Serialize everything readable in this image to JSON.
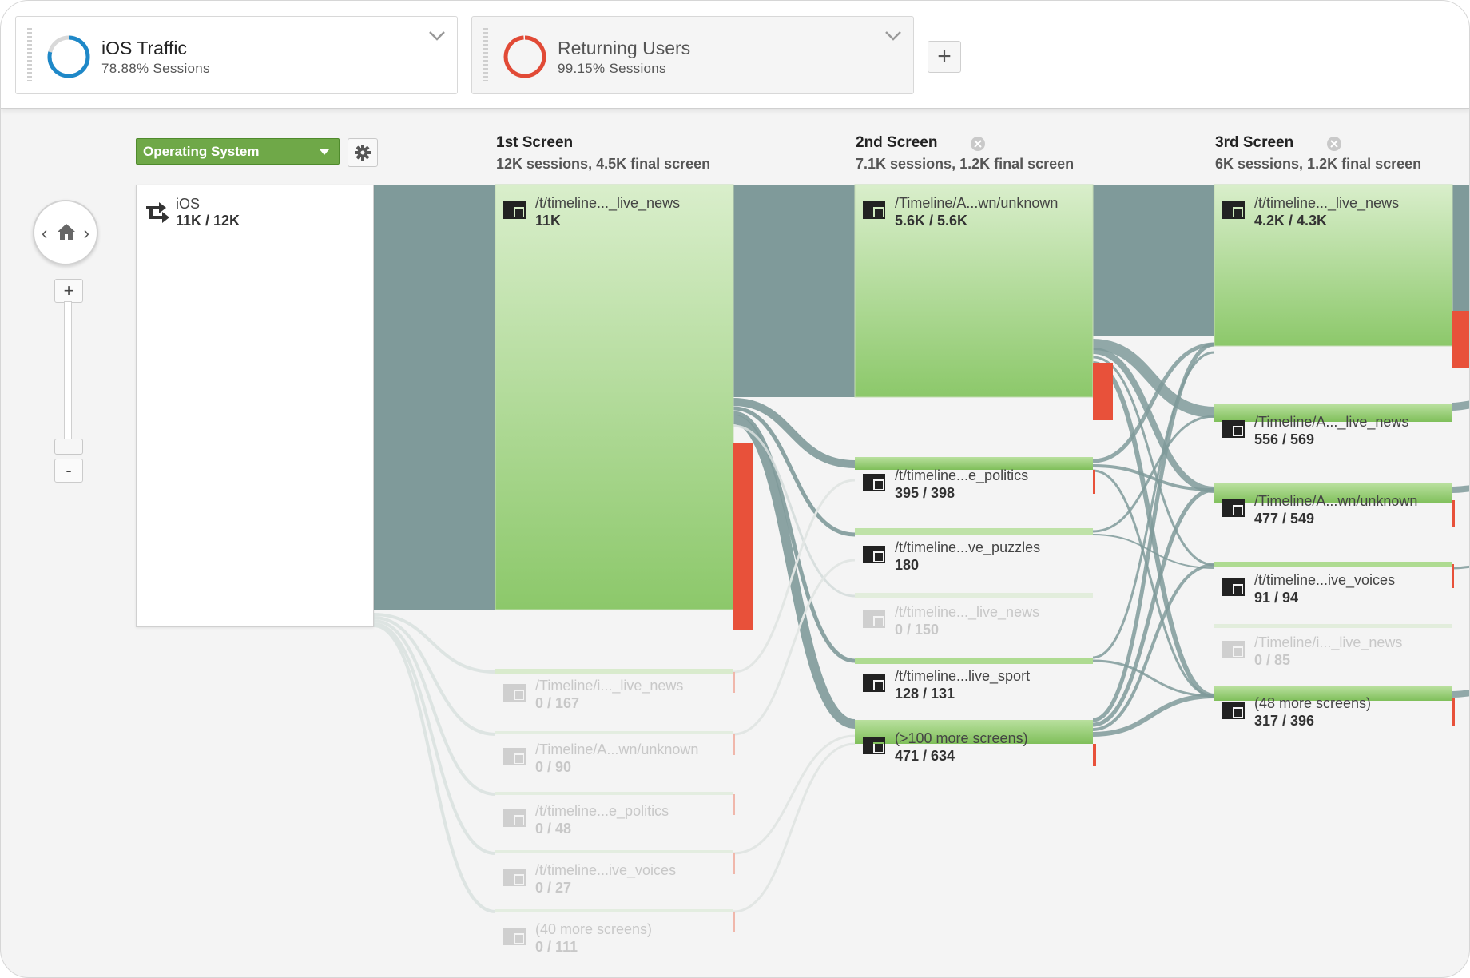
{
  "segments": [
    {
      "title": "iOS Traffic",
      "subtitle": "78.88% Sessions",
      "color": "#1e88c8"
    },
    {
      "title": "Returning Users",
      "subtitle": "99.15% Sessions",
      "color": "#e14a36"
    }
  ],
  "add_segment_label": "+",
  "dimension": {
    "label": "Operating System"
  },
  "navigation": {
    "left": "‹",
    "right": "›",
    "zoom_in": "+",
    "zoom_out": "-"
  },
  "columns": [
    {
      "title": "1st Screen",
      "subtitle": "12K sessions, 4.5K final screen"
    },
    {
      "title": "2nd Screen",
      "subtitle": "7.1K sessions, 1.2K final screen"
    },
    {
      "title": "3rd Screen",
      "subtitle": "6K sessions, 1.2K final screen"
    }
  ],
  "starting_node": {
    "label": "iOS",
    "value": "11K / 12K"
  },
  "screen1_nodes": [
    {
      "label": "/t/timeline..._live_news",
      "value": "11K"
    },
    {
      "label": "/Timeline/i..._live_news",
      "value": "0 / 167"
    },
    {
      "label": "/Timeline/A...wn/unknown",
      "value": "0 / 90"
    },
    {
      "label": "/t/timeline...e_politics",
      "value": "0 / 48"
    },
    {
      "label": "/t/timeline...ive_voices",
      "value": "0 / 27"
    },
    {
      "label": "(40 more screens)",
      "value": "0 / 111"
    }
  ],
  "screen2_nodes": [
    {
      "label": "/Timeline/A...wn/unknown",
      "value": "5.6K / 5.6K"
    },
    {
      "label": "/t/timeline...e_politics",
      "value": "395 / 398"
    },
    {
      "label": "/t/timeline...ve_puzzles",
      "value": "180"
    },
    {
      "label": "/t/timeline..._live_news",
      "value": "0 / 150"
    },
    {
      "label": "/t/timeline...live_sport",
      "value": "128 / 131"
    },
    {
      "label": "(>100 more screens)",
      "value": "471 / 634"
    }
  ],
  "screen3_nodes": [
    {
      "label": "/t/timeline..._live_news",
      "value": "4.2K / 4.3K"
    },
    {
      "label": "/Timeline/A..._live_news",
      "value": "556 / 569"
    },
    {
      "label": "/Timeline/A...wn/unknown",
      "value": "477 / 549"
    },
    {
      "label": "/t/timeline...ive_voices",
      "value": "91 / 94"
    },
    {
      "label": "/Timeline/i..._live_news",
      "value": "0 / 85"
    },
    {
      "label": "(48 more screens)",
      "value": "317 / 396"
    }
  ],
  "colors": {
    "node_green": "#8cc86a",
    "flow": "#7f9a9a",
    "dropoff": "#e8513a"
  }
}
